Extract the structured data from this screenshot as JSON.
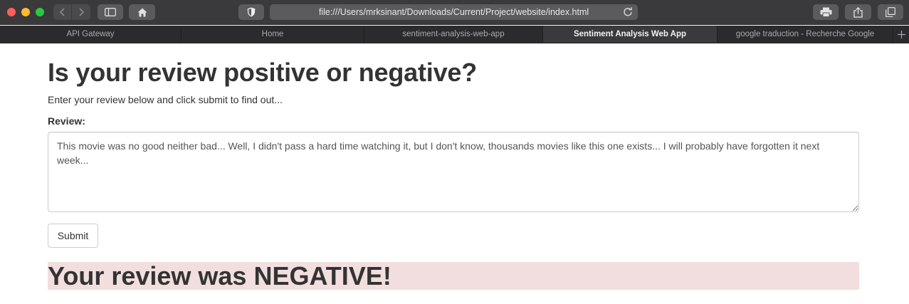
{
  "browser": {
    "url": "file:///Users/mrksinant/Downloads/Current/Project/website/index.html",
    "icons": {
      "back": "chevron-left-icon",
      "forward": "chevron-right-icon",
      "sidebar": "sidebar-icon",
      "home": "home-icon",
      "shield": "shield-icon",
      "reload": "reload-icon",
      "print": "printer-icon",
      "share": "share-icon",
      "tabs": "tabs-overview-icon",
      "new_tab": "plus-icon"
    },
    "tabs": [
      {
        "label": "API Gateway",
        "active": false
      },
      {
        "label": "Home",
        "active": false
      },
      {
        "label": "sentiment-analysis-web-app",
        "active": false
      },
      {
        "label": "Sentiment Analysis Web App",
        "active": true
      },
      {
        "label": "google traduction - Recherche Google",
        "active": false
      }
    ]
  },
  "page": {
    "heading": "Is your review positive or negative?",
    "subtitle": "Enter your review below and click submit to find out...",
    "review_label": "Review:",
    "review_text": "This movie was no good neither bad... Well, I didn't pass a hard time watching it, but I don't know, thousands movies like this one exists... I will probably have forgotten it next week...",
    "submit_label": "Submit",
    "result": "Your review was NEGATIVE!",
    "result_color": "#f2dede"
  },
  "colors": {
    "chrome_toolbar": "#3a3a3c",
    "chrome_tabbar": "#2b2b2d",
    "text": "#333333",
    "traffic_red": "#ff5f57",
    "traffic_yellow": "#febc2e",
    "traffic_green": "#28c840"
  }
}
